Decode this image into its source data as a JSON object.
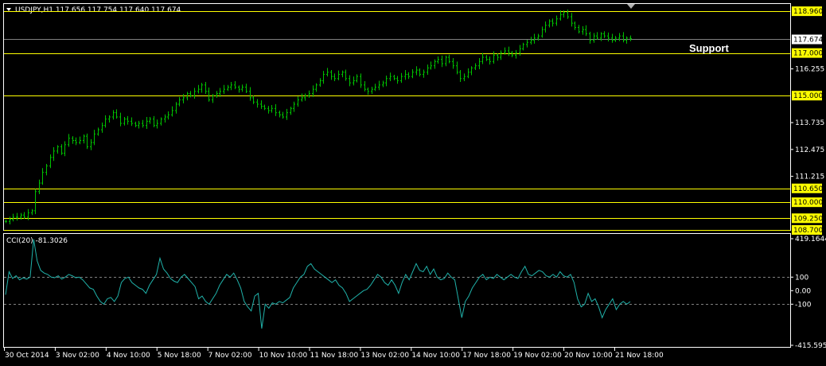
{
  "window": {
    "symbol_header": "USDJPY,H1  117.656 117.754 117.640 117.674",
    "menu_icon": "triangle-down-icon",
    "scroll_marker_icon": "triangle-down-icon"
  },
  "annotation": {
    "text": "Support"
  },
  "colors": {
    "background": "#000000",
    "candles": "#00c000",
    "level_lines": "#ffff00",
    "level_tag_bg": "#ffff00",
    "current_price_tag_bg": "#ffffff",
    "cci_line": "#20b2aa",
    "grid": "#808080",
    "frame": "#ffffff"
  },
  "price_axis": {
    "ticks": [
      "116.255",
      "113.735",
      "112.475",
      "111.215"
    ],
    "current_price": "117.674",
    "levels": [
      "118.960",
      "117.000",
      "115.000",
      "110.650",
      "110.000",
      "109.250",
      "108.700"
    ]
  },
  "indicator": {
    "header": "CCI(20) -81.3026",
    "ticks": [
      "419.1644",
      "100",
      "0.00",
      "-100",
      "-415.5955"
    ]
  },
  "time_axis": {
    "labels": [
      "30 Oct 2014",
      "3 Nov 02:00",
      "4 Nov 10:00",
      "5 Nov 18:00",
      "7 Nov 02:00",
      "10 Nov 10:00",
      "11 Nov 18:00",
      "13 Nov 02:00",
      "14 Nov 10:00",
      "17 Nov 18:00",
      "19 Nov 02:00",
      "20 Nov 10:00",
      "21 Nov 18:00"
    ]
  },
  "chart_data": [
    {
      "type": "line",
      "title": "USDJPY,H1",
      "x_start": "30 Oct 2014",
      "ylim": [
        108.7,
        119.3
      ],
      "series": [
        {
          "name": "USDJPY",
          "values": [
            109.1,
            109.2,
            109.3,
            109.3,
            109.4,
            109.3,
            109.5,
            109.6,
            110.5,
            110.9,
            111.4,
            111.7,
            112.1,
            112.4,
            112.6,
            112.3,
            112.7,
            113.0,
            112.9,
            112.8,
            112.9,
            113.1,
            112.6,
            112.8,
            113.2,
            113.4,
            113.6,
            113.9,
            114.0,
            114.2,
            114.0,
            113.7,
            113.9,
            113.8,
            113.7,
            113.6,
            113.7,
            113.6,
            113.8,
            113.9,
            113.6,
            113.7,
            113.9,
            114.0,
            114.1,
            114.3,
            114.6,
            114.8,
            114.9,
            115.1,
            115.0,
            115.2,
            115.3,
            115.5,
            115.2,
            114.8,
            115.0,
            115.1,
            115.2,
            115.3,
            115.4,
            115.5,
            115.4,
            115.3,
            115.4,
            115.2,
            114.9,
            114.7,
            114.6,
            114.5,
            114.4,
            114.3,
            114.4,
            114.2,
            114.1,
            114.0,
            114.2,
            114.4,
            114.6,
            114.8,
            114.9,
            115.0,
            115.1,
            115.3,
            115.5,
            115.7,
            116.0,
            116.1,
            115.9,
            115.8,
            116.0,
            116.1,
            115.8,
            115.6,
            115.7,
            115.9,
            115.5,
            115.3,
            115.2,
            115.3,
            115.4,
            115.5,
            115.6,
            115.8,
            115.9,
            115.8,
            115.7,
            115.9,
            116.0,
            115.9,
            116.1,
            116.2,
            116.0,
            116.1,
            116.3,
            116.4,
            116.6,
            116.7,
            116.5,
            116.8,
            116.6,
            116.4,
            116.1,
            115.8,
            115.9,
            116.1,
            116.3,
            116.4,
            116.6,
            116.8,
            116.7,
            116.6,
            116.9,
            116.8,
            117.0,
            117.1,
            117.0,
            116.9,
            117.0,
            117.2,
            117.4,
            117.5,
            117.6,
            117.7,
            117.8,
            118.1,
            118.3,
            118.5,
            118.4,
            118.6,
            118.8,
            118.9,
            118.7,
            118.4,
            118.2,
            118.0,
            118.1,
            117.9,
            117.6,
            117.8,
            117.7,
            117.9,
            117.8,
            117.7,
            117.6,
            117.7,
            117.8,
            117.6,
            117.7,
            117.674
          ]
        }
      ],
      "levels": [
        118.96,
        117.0,
        115.0,
        110.65,
        110.0,
        109.25,
        108.7
      ]
    },
    {
      "type": "line",
      "title": "CCI(20)",
      "ylim": [
        -415.5955,
        419.1644
      ],
      "series": [
        {
          "name": "CCI(20)",
          "values": [
            -30,
            140,
            90,
            110,
            80,
            95,
            85,
            100,
            380,
            220,
            150,
            130,
            120,
            100,
            95,
            110,
            85,
            100,
            120,
            110,
            95,
            100,
            80,
            50,
            20,
            10,
            -40,
            -80,
            -100,
            -60,
            -50,
            -80,
            -40,
            60,
            90,
            100,
            60,
            40,
            20,
            10,
            -20,
            40,
            80,
            120,
            240,
            160,
            130,
            90,
            70,
            60,
            100,
            120,
            90,
            60,
            30,
            -60,
            -40,
            -80,
            -100,
            -60,
            -20,
            40,
            80,
            120,
            100,
            130,
            80,
            20,
            -80,
            -120,
            -150,
            -40,
            -20,
            -280,
            -100,
            -130,
            -90,
            -100,
            -80,
            -90,
            -70,
            -50,
            20,
            60,
            100,
            120,
            180,
            200,
            160,
            140,
            120,
            100,
            80,
            60,
            80,
            40,
            20,
            -20,
            -80,
            -60,
            -40,
            -20,
            0,
            10,
            40,
            80,
            120,
            100,
            60,
            40,
            80,
            40,
            -20,
            60,
            120,
            80,
            140,
            200,
            150,
            140,
            180,
            120,
            160,
            100,
            80,
            90,
            130,
            100,
            80,
            -60,
            -200,
            -80,
            -40,
            20,
            60,
            100,
            120,
            80,
            100,
            90,
            120,
            100,
            80,
            100,
            120,
            100,
            90,
            140,
            180,
            120,
            110,
            130,
            150,
            140,
            110,
            100,
            120,
            100,
            140,
            110,
            100,
            120,
            60,
            -60,
            -120,
            -100,
            -20,
            -80,
            -60,
            -120,
            -200,
            -140,
            -100,
            -60,
            -140,
            -100,
            -80,
            -100,
            -81.3026
          ]
        }
      ],
      "reference_lines": [
        100,
        -100
      ]
    }
  ]
}
